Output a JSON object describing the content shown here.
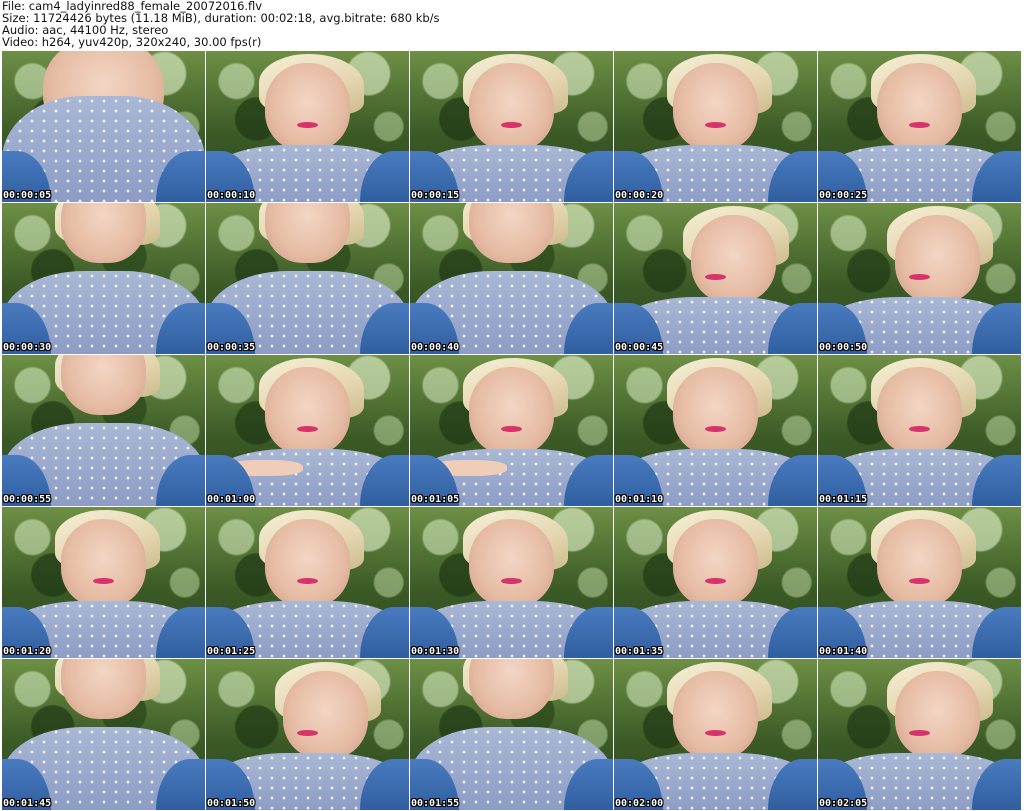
{
  "header": {
    "file_line": "File: cam4_ladyinred88_female_20072016.flv",
    "size_line": "Size: 11724426 bytes (11.18 MiB), duration: 00:02:18, avg.bitrate: 680 kb/s",
    "audio_line": "Audio: aac, 44100 Hz, stereo",
    "video_line": "Video: h264, yuv420p, 320x240, 30.00 fps(r)"
  },
  "thumbnails": [
    {
      "time": "00:00:05",
      "variant": "v-close"
    },
    {
      "time": "00:00:10",
      "variant": ""
    },
    {
      "time": "00:00:15",
      "variant": ""
    },
    {
      "time": "00:00:20",
      "variant": ""
    },
    {
      "time": "00:00:25",
      "variant": ""
    },
    {
      "time": "00:00:30",
      "variant": "v-low"
    },
    {
      "time": "00:00:35",
      "variant": "v-low"
    },
    {
      "time": "00:00:40",
      "variant": "v-low"
    },
    {
      "time": "00:00:45",
      "variant": "v-side"
    },
    {
      "time": "00:00:50",
      "variant": "v-side"
    },
    {
      "time": "00:00:55",
      "variant": "v-low"
    },
    {
      "time": "00:01:00",
      "variant": "v-hand"
    },
    {
      "time": "00:01:05",
      "variant": "v-hand"
    },
    {
      "time": "00:01:10",
      "variant": ""
    },
    {
      "time": "00:01:15",
      "variant": ""
    },
    {
      "time": "00:01:20",
      "variant": ""
    },
    {
      "time": "00:01:25",
      "variant": ""
    },
    {
      "time": "00:01:30",
      "variant": ""
    },
    {
      "time": "00:01:35",
      "variant": ""
    },
    {
      "time": "00:01:40",
      "variant": ""
    },
    {
      "time": "00:01:45",
      "variant": "v-low"
    },
    {
      "time": "00:01:50",
      "variant": "v-side"
    },
    {
      "time": "00:01:55",
      "variant": "v-low"
    },
    {
      "time": "00:02:00",
      "variant": ""
    },
    {
      "time": "00:02:05",
      "variant": "v-side"
    }
  ]
}
